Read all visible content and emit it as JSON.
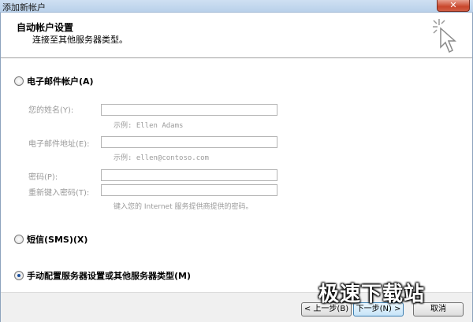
{
  "window": {
    "title": "添加新帐户",
    "close_label": "✕"
  },
  "header": {
    "title": "自动帐户设置",
    "subtitle": "连接至其他服务器类型。"
  },
  "options": {
    "email_account": "电子邮件帐户(A)",
    "sms": "短信(SMS)(X)",
    "manual": "手动配置服务器设置或其他服务器类型(M)",
    "selected": "manual"
  },
  "fields": {
    "name_label": "您的姓名(Y):",
    "name_hint": "示例: Ellen Adams",
    "email_label": "电子邮件地址(E):",
    "email_hint": "示例: ellen@contoso.com",
    "password_label": "密码(P):",
    "retype_label": "重新键入密码(T):",
    "password_hint": "键入您的 Internet 服务提供商提供的密码。"
  },
  "buttons": {
    "back": "< 上一步(B)",
    "next": "下一步(N) >",
    "cancel": "取消"
  },
  "watermark": {
    "text": "极速下载站"
  }
}
